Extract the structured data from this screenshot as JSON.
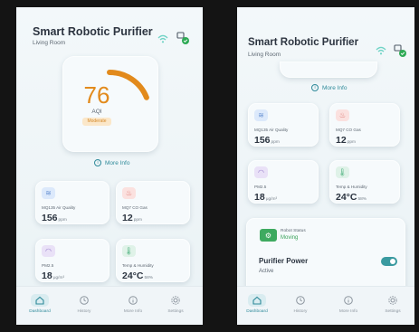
{
  "app": {
    "title": "Smart Robotic Purifier",
    "subtitle": "Living Room"
  },
  "aqi": {
    "value": "76",
    "label": "AQI",
    "status": "Moderate",
    "level_fraction": 0.38,
    "color": "#e28a1c"
  },
  "more_info": "More Info",
  "sensors": [
    {
      "label": "MQ135 Air Quality",
      "value": "156",
      "unit": "ppm",
      "icon": "wind-icon"
    },
    {
      "label": "MQ7 CO Gas",
      "value": "12",
      "unit": "ppm",
      "icon": "flame-icon"
    },
    {
      "label": "PM2.5",
      "value": "18",
      "unit": "μg/m³",
      "icon": "gauge-icon"
    },
    {
      "label": "Temp & Humidity",
      "value": "24°C",
      "unit": "58%",
      "icon": "thermometer-icon"
    }
  ],
  "robot": {
    "title": "Robot Status",
    "status": "Moving",
    "status_color": "#3aa35a"
  },
  "purifier": {
    "title": "Purifier Power",
    "state": "Active",
    "toggle_on": true
  },
  "nav": [
    {
      "label": "Dashboard",
      "icon": "home-icon"
    },
    {
      "label": "History",
      "icon": "clock-icon"
    },
    {
      "label": "More Info",
      "icon": "info-icon"
    },
    {
      "label": "Settings",
      "icon": "gear-icon"
    }
  ],
  "colors": {
    "accent": "#2f8a9a",
    "online_badge": "#2eaa55",
    "wifi": "#6fd3c5"
  }
}
